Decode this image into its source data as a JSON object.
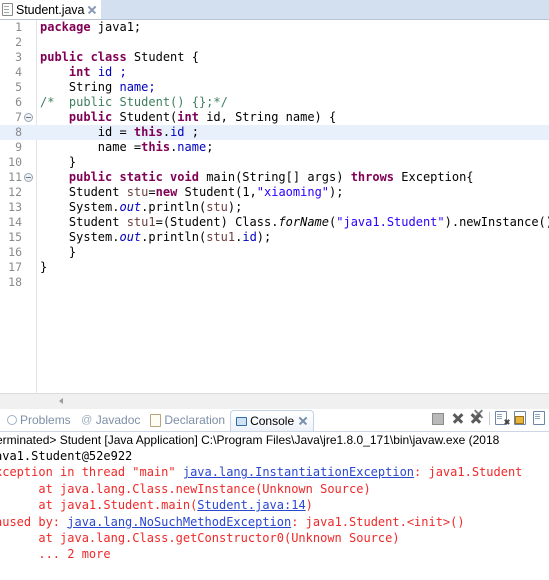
{
  "editor_tab": {
    "label": "Student.java",
    "close_icon": "close-icon",
    "doc_icon": "java-file-icon"
  },
  "code": {
    "lines": [
      {
        "num": "1",
        "fold": false,
        "cur": false,
        "tokens": [
          {
            "t": "package ",
            "c": "k"
          },
          {
            "t": "java1;",
            "c": "p"
          }
        ]
      },
      {
        "num": "2",
        "fold": false,
        "cur": false,
        "tokens": []
      },
      {
        "num": "3",
        "fold": false,
        "cur": false,
        "tokens": [
          {
            "t": "public class ",
            "c": "k"
          },
          {
            "t": "Student {",
            "c": "p"
          }
        ]
      },
      {
        "num": "4",
        "fold": false,
        "cur": false,
        "tokens": [
          {
            "t": "    ",
            "c": "p"
          },
          {
            "t": "int ",
            "c": "k"
          },
          {
            "t": "id ;",
            "c": "f"
          }
        ]
      },
      {
        "num": "5",
        "fold": false,
        "cur": false,
        "tokens": [
          {
            "t": "    String ",
            "c": "p"
          },
          {
            "t": "name;",
            "c": "f"
          }
        ]
      },
      {
        "num": "6",
        "fold": false,
        "cur": false,
        "tokens": [
          {
            "t": "/*  public Student() {};*/",
            "c": "c"
          }
        ]
      },
      {
        "num": "7",
        "fold": true,
        "cur": false,
        "tokens": [
          {
            "t": "    ",
            "c": "p"
          },
          {
            "t": "public ",
            "c": "k"
          },
          {
            "t": "Student(",
            "c": "p"
          },
          {
            "t": "int ",
            "c": "k"
          },
          {
            "t": "id, String name) {",
            "c": "p"
          }
        ]
      },
      {
        "num": "8",
        "fold": false,
        "cur": true,
        "tokens": [
          {
            "t": "        id = ",
            "c": "p"
          },
          {
            "t": "this",
            "c": "k"
          },
          {
            "t": ".",
            "c": "p"
          },
          {
            "t": "id",
            "c": "f"
          },
          {
            "t": " ;",
            "c": "p"
          }
        ]
      },
      {
        "num": "9",
        "fold": false,
        "cur": false,
        "tokens": [
          {
            "t": "        name =",
            "c": "p"
          },
          {
            "t": "this",
            "c": "k"
          },
          {
            "t": ".",
            "c": "p"
          },
          {
            "t": "name",
            "c": "f"
          },
          {
            "t": ";",
            "c": "p"
          }
        ]
      },
      {
        "num": "10",
        "fold": false,
        "cur": false,
        "tokens": [
          {
            "t": "    }",
            "c": "p"
          }
        ]
      },
      {
        "num": "11",
        "fold": true,
        "cur": false,
        "tokens": [
          {
            "t": "    ",
            "c": "p"
          },
          {
            "t": "public static void ",
            "c": "k"
          },
          {
            "t": "main(String[] args) ",
            "c": "p"
          },
          {
            "t": "throws ",
            "c": "k"
          },
          {
            "t": "Exception{",
            "c": "p"
          }
        ]
      },
      {
        "num": "12",
        "fold": false,
        "cur": false,
        "tokens": [
          {
            "t": "    Student ",
            "c": "p"
          },
          {
            "t": "stu",
            "c": "v"
          },
          {
            "t": "=",
            "c": "p"
          },
          {
            "t": "new ",
            "c": "k"
          },
          {
            "t": "Student(1,",
            "c": "p"
          },
          {
            "t": "\"xiaoming\"",
            "c": "s"
          },
          {
            "t": ");",
            "c": "p"
          }
        ]
      },
      {
        "num": "13",
        "fold": false,
        "cur": false,
        "tokens": [
          {
            "t": "    System.",
            "c": "p"
          },
          {
            "t": "out",
            "c": "stf"
          },
          {
            "t": ".println(",
            "c": "p"
          },
          {
            "t": "stu",
            "c": "v"
          },
          {
            "t": ");",
            "c": "p"
          }
        ]
      },
      {
        "num": "14",
        "fold": false,
        "cur": false,
        "tokens": [
          {
            "t": "    Student ",
            "c": "p"
          },
          {
            "t": "stu1",
            "c": "v"
          },
          {
            "t": "=(Student) Class.",
            "c": "p"
          },
          {
            "t": "forName",
            "c": "st"
          },
          {
            "t": "(",
            "c": "p"
          },
          {
            "t": "\"java1.Student\"",
            "c": "s"
          },
          {
            "t": ").newInstance();",
            "c": "p"
          }
        ]
      },
      {
        "num": "15",
        "fold": false,
        "cur": false,
        "tokens": [
          {
            "t": "    System.",
            "c": "p"
          },
          {
            "t": "out",
            "c": "stf"
          },
          {
            "t": ".println(",
            "c": "p"
          },
          {
            "t": "stu1",
            "c": "v"
          },
          {
            "t": ".",
            "c": "p"
          },
          {
            "t": "id",
            "c": "f"
          },
          {
            "t": ");",
            "c": "p"
          }
        ]
      },
      {
        "num": "16",
        "fold": false,
        "cur": false,
        "tokens": [
          {
            "t": "    }",
            "c": "p"
          }
        ]
      },
      {
        "num": "17",
        "fold": false,
        "cur": false,
        "tokens": [
          {
            "t": "}",
            "c": "p"
          }
        ]
      },
      {
        "num": "18",
        "fold": false,
        "cur": false,
        "tokens": []
      }
    ]
  },
  "view_tabs": [
    {
      "label": "Problems",
      "icon": "problems-icon",
      "active": false,
      "closable": false
    },
    {
      "label": "Javadoc",
      "icon": "javadoc-icon",
      "active": false,
      "closable": false
    },
    {
      "label": "Declaration",
      "icon": "declaration-icon",
      "active": false,
      "closable": false
    },
    {
      "label": "Console",
      "icon": "console-icon",
      "active": true,
      "closable": true
    }
  ],
  "view_toolbar": [
    {
      "name": "terminate-button",
      "icon": "stop-square-icon"
    },
    {
      "name": "remove-launch-button",
      "icon": "x-icon"
    },
    {
      "name": "remove-all-launches-button",
      "icon": "double-x-icon"
    },
    {
      "name": "clear-console-button",
      "icon": "clear-console-icon"
    },
    {
      "name": "scroll-lock-button",
      "icon": "lock-icon"
    },
    {
      "name": "pin-console-button",
      "icon": "pin-console-icon"
    }
  ],
  "console": {
    "header": "erminated> Student [Java Application] C:\\Program Files\\Java\\jre1.8.0_171\\bin\\javaw.exe (2018",
    "lines": [
      {
        "segs": [
          {
            "t": "ava1.Student@52e922",
            "c": "blk"
          }
        ]
      },
      {
        "segs": [
          {
            "t": "xception in thread \"main\" ",
            "c": "red"
          },
          {
            "t": "java.lang.InstantiationException",
            "c": "lnk"
          },
          {
            "t": ": java1.Student",
            "c": "red"
          }
        ]
      },
      {
        "segs": [
          {
            "t": "      at java.lang.Class.newInstance(Unknown Source)",
            "c": "red"
          }
        ]
      },
      {
        "segs": [
          {
            "t": "      at java1.Student.main(",
            "c": "red"
          },
          {
            "t": "Student.java:14",
            "c": "lnk"
          },
          {
            "t": ")",
            "c": "red"
          }
        ]
      },
      {
        "segs": [
          {
            "t": "aused by: ",
            "c": "red"
          },
          {
            "t": "java.lang.NoSuchMethodException",
            "c": "lnk"
          },
          {
            "t": ": java1.Student.<init>()",
            "c": "red"
          }
        ]
      },
      {
        "segs": [
          {
            "t": "      at java.lang.Class.getConstructor0(Unknown Source)",
            "c": "red"
          }
        ]
      },
      {
        "segs": [
          {
            "t": "      ... 2 more",
            "c": "red"
          }
        ]
      }
    ]
  },
  "colors": {
    "keyword": "#7F0055",
    "string": "#2A00FF",
    "comment": "#3F7F5F",
    "field": "#0000C0",
    "local_var": "#6A3E3E",
    "console_error": "#EF2929",
    "console_link": "#2A47CF",
    "current_line": "#E8F0FB",
    "tab_filler": "#D3E0F0"
  }
}
